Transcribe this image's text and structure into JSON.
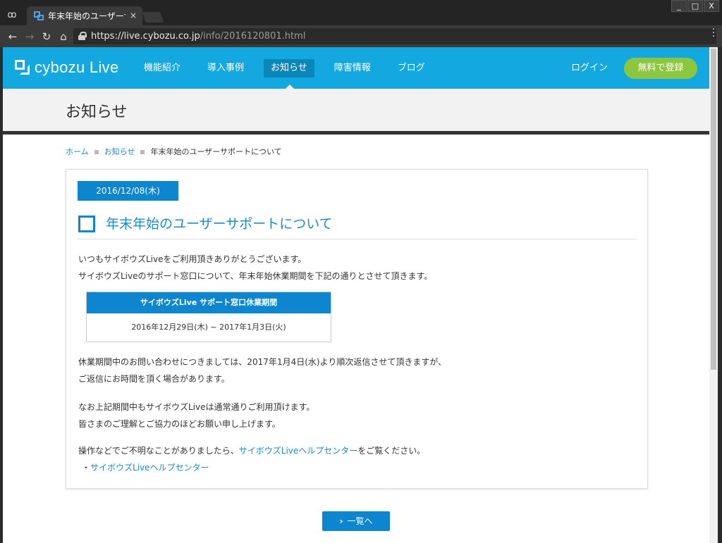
{
  "browser": {
    "tab_title": "年末年始のユーザーサポ",
    "tab_close": "×",
    "url_host": "https://live.cybozu.co.jp",
    "url_path": "/info/2016120801.html",
    "window_buttons": [
      "_",
      "□",
      "X"
    ]
  },
  "site": {
    "logo": "cybozu Live",
    "nav": [
      "機能紹介",
      "導入事例",
      "お知らせ",
      "障害情報",
      "ブログ"
    ],
    "active_nav": "お知らせ",
    "login": "ログイン",
    "signup": "無料で登録",
    "brand_color": "#14a8e0",
    "accent_color": "#0e86cf",
    "signup_color": "#8cc63f"
  },
  "page": {
    "title": "お知らせ",
    "breadcrumb": {
      "home": "ホーム",
      "section": "お知らせ",
      "current": "年末年始のユーザーサポートについて"
    }
  },
  "article": {
    "date": "2016/12/08(木)",
    "heading": "年末年始のユーザーサポートについて",
    "intro_1": "いつもサイボウズLiveをご利用頂きありがとうございます。",
    "intro_2": "サイボウズLiveのサポート窓口について、年末年始休業期間を下記の通りとさせて頂きます。",
    "table_header": "サイボウズLive サポート窓口休業期間",
    "table_value": "2016年12月29日(木) ~ 2017年1月3日(火)",
    "body_1": "休業期間中のお問い合わせにつきましては、2017年1月4日(水)より順次返信させて頂きますが、",
    "body_2": "ご返信にお時間を頂く場合があります。",
    "body_3": "なお上記期間中もサイボウズLiveは通常通りご利用頂けます。",
    "body_4": "皆さまのご理解とご協力のほどお願い申し上げます。",
    "help_prefix": "操作などでご不明なことがありましたら、",
    "help_link": "サイボウズLiveヘルプセンター",
    "help_suffix": "をご覧ください。",
    "bullet_prefix": "・",
    "bullet_link": "サイボウズLiveヘルプセンター"
  },
  "footer": {
    "more_button": "一覧へ"
  }
}
